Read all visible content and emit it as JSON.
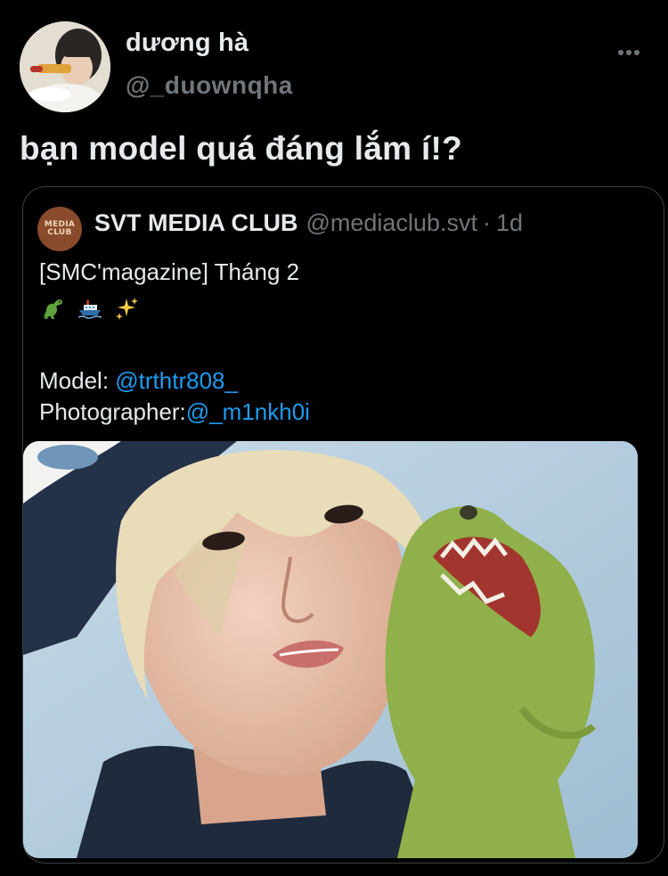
{
  "tweet": {
    "display_name": "dương hà",
    "handle": "@_duownqha",
    "text": "bạn model quá đáng lắm í!?",
    "more_icon": "more-horizontal-icon"
  },
  "quoted_tweet": {
    "avatar_logo_line1": "MEDIA",
    "avatar_logo_line2": "CLUB",
    "display_name": "SVT MEDIA CLUB",
    "handle": "@mediaclub.svt",
    "separator": "·",
    "time": "1d",
    "body_title": "[SMC'magazine] Tháng 2",
    "emojis": [
      "dinosaur-icon",
      "ship-icon",
      "sparkles-icon"
    ],
    "model_label": "Model: ",
    "model_mention": "@trthtr808_",
    "photographer_label": "Photographer:",
    "photographer_mention": "@_m1nkh0i",
    "photo": "photo-portrait-with-dinosaur-plush"
  },
  "colors": {
    "background": "#000000",
    "text": "#e7e9ea",
    "muted": "#71767b",
    "link": "#1d9bf0",
    "border": "#3c4043"
  }
}
